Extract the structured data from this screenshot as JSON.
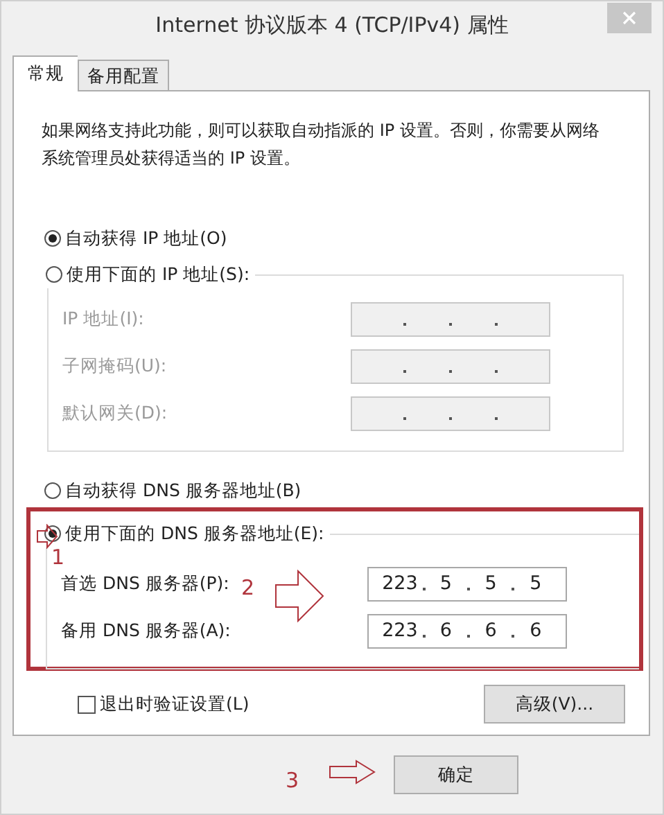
{
  "window": {
    "title": "Internet 协议版本 4 (TCP/IPv4) 属性"
  },
  "tabs": [
    {
      "label": "常规",
      "selected": true
    },
    {
      "label": "备用配置",
      "selected": false
    }
  ],
  "description": "如果网络支持此功能，则可以获取自动指派的 IP 设置。否则，你需要从网络系统管理员处获得适当的 IP 设置。",
  "ip_options": [
    {
      "label": "自动获得 IP 地址(O)",
      "selected": true
    },
    {
      "label": "使用下面的 IP 地址(S):",
      "selected": false
    }
  ],
  "ip_fields": [
    {
      "label": "IP 地址(I):",
      "disabled": true
    },
    {
      "label": "子网掩码(U):",
      "disabled": true
    },
    {
      "label": "默认网关(D):",
      "disabled": true
    }
  ],
  "dns_options": [
    {
      "label": "自动获得 DNS 服务器地址(B)",
      "selected": false
    },
    {
      "label": "使用下面的 DNS 服务器地址(E):",
      "selected": true
    }
  ],
  "dns_fields": [
    {
      "label": "首选 DNS 服务器(P):",
      "disabled": false,
      "octets": [
        "223",
        "5",
        "5",
        "5"
      ]
    },
    {
      "label": "备用 DNS 服务器(A):",
      "disabled": false,
      "octets": [
        "223",
        "6",
        "6",
        "6"
      ]
    }
  ],
  "validate_checkbox": {
    "label": "退出时验证设置(L)",
    "checked": false
  },
  "advanced_button": "高级(V)...",
  "ok_button": "确定",
  "annotations": [
    "1",
    "2",
    "3"
  ]
}
